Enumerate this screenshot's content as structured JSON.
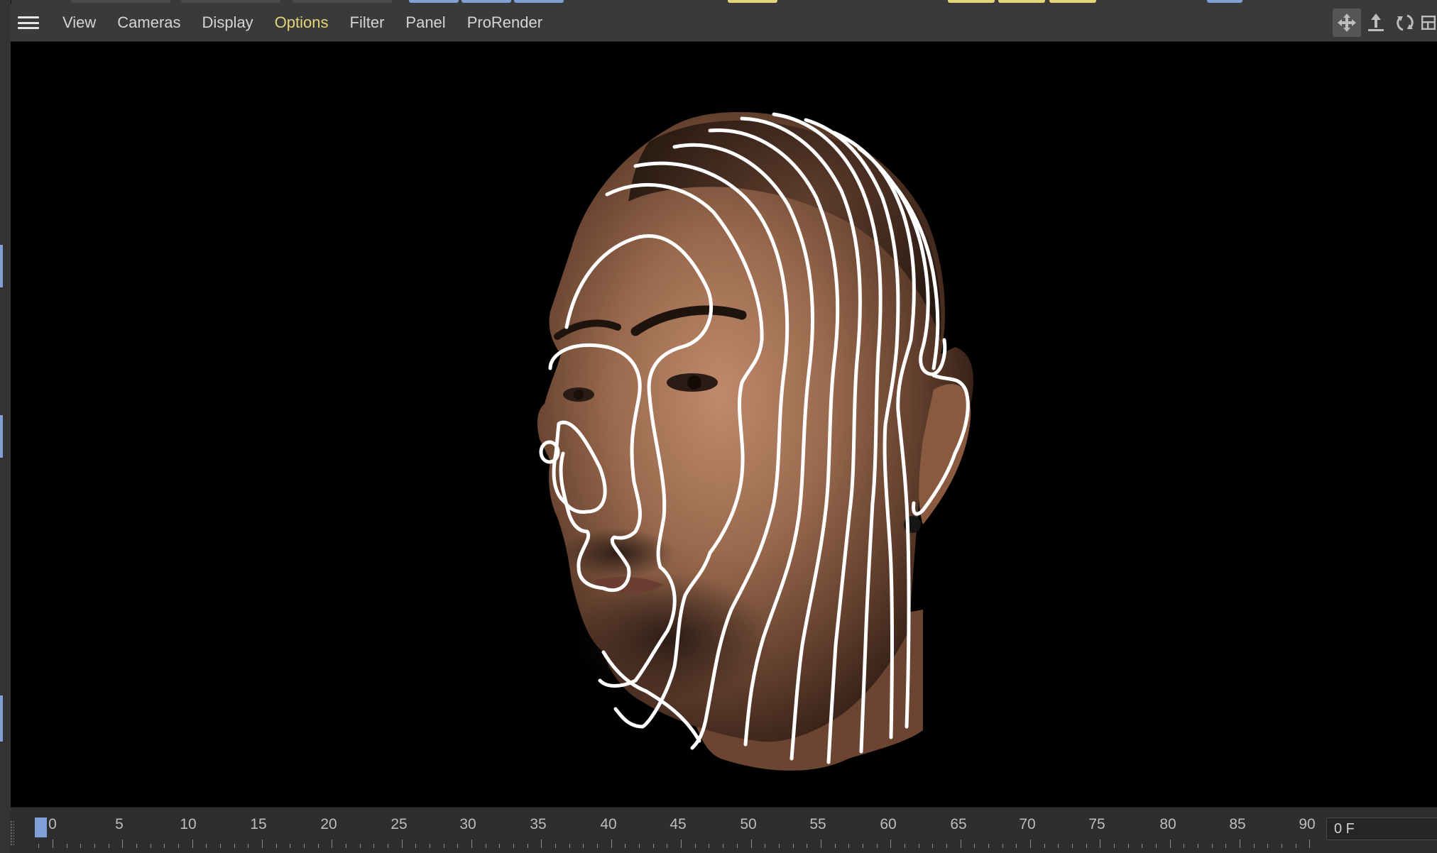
{
  "menubar": {
    "menu_icon": "hamburger-menu-icon",
    "items": [
      {
        "label": "View"
      },
      {
        "label": "Cameras"
      },
      {
        "label": "Display"
      },
      {
        "label": "Options",
        "active": true
      },
      {
        "label": "Filter"
      },
      {
        "label": "Panel"
      },
      {
        "label": "ProRender"
      }
    ],
    "nav_icons": [
      "move-view-icon",
      "dolly-view-icon",
      "rotate-view-icon",
      "maximize-view-icon"
    ]
  },
  "viewport": {
    "subject": "3d-head-with-contour-lines"
  },
  "timeline": {
    "labels": [
      "0",
      "5",
      "10",
      "15",
      "20",
      "25",
      "30",
      "35",
      "40",
      "45",
      "50",
      "55",
      "60",
      "65",
      "70",
      "75",
      "80",
      "85",
      "90"
    ],
    "current_frame": "0 F",
    "playhead_frame": 0
  },
  "colors": {
    "menu_text": "#d4d4d4",
    "active_menu": "#e4d47a",
    "accent_blue": "#7f9fd6",
    "panel_bg": "#3a3a3a",
    "viewport_bg": "#000000",
    "contour_line": "#ffffff",
    "skin": "#8a5c42"
  }
}
